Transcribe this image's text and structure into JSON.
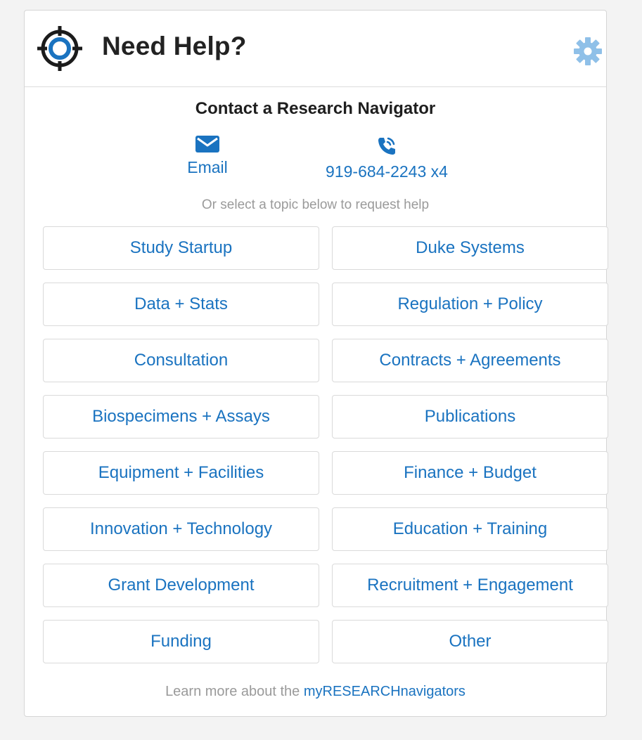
{
  "header": {
    "title": "Need Help?",
    "logo_icon": "lifebuoy-target-icon",
    "settings_icon": "gear-icon"
  },
  "contact": {
    "title": "Contact a Research Navigator",
    "email": {
      "icon": "envelope-icon",
      "label": "Email"
    },
    "phone": {
      "icon": "phone-icon",
      "label": "919-684-2243 x4"
    },
    "subtitle": "Or select a topic below to request help"
  },
  "topics": [
    "Study Startup",
    "Duke Systems",
    "Data + Stats",
    "Regulation + Policy",
    "Consultation",
    "Contracts + Agreements",
    "Biospecimens + Assays",
    "Publications",
    "Equipment + Facilities",
    "Finance + Budget",
    "Innovation + Technology",
    "Education + Training",
    "Grant Development",
    "Recruitment + Engagement",
    "Funding",
    "Other"
  ],
  "footer": {
    "text": "Learn more about the ",
    "link": "myRESEARCHnavigators"
  },
  "colors": {
    "accent": "#1a73c0",
    "muted": "#9a9a9a",
    "gear": "#8fc0e8"
  }
}
